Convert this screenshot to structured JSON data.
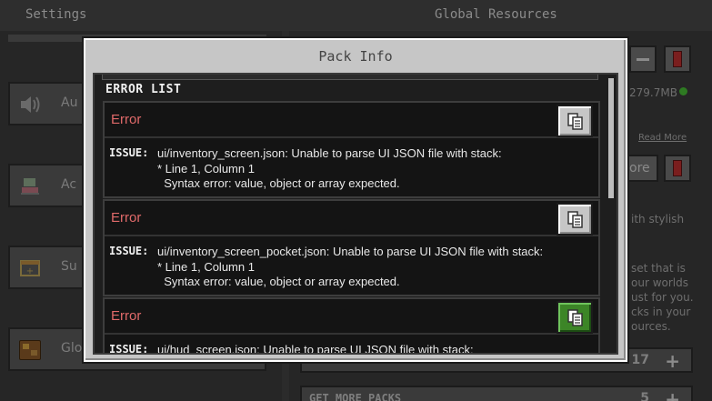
{
  "background": {
    "header_left": "Settings",
    "header_right": "Global Resources",
    "left_items": [
      {
        "label": "Au",
        "icon": "speaker-icon"
      },
      {
        "label": "Ac",
        "icon": "accessibility-icon"
      },
      {
        "label": "Su",
        "icon": "subtitles-icon"
      },
      {
        "label": "Glo",
        "icon": "global-resources-icon"
      }
    ],
    "right": {
      "size_text": "279.7MB",
      "read_more": "Read More",
      "ore_btn": "ore",
      "desc_lines": [
        "ith stylish",
        "set that is",
        "our worlds",
        "ust for you.",
        "cks in your",
        "ources."
      ],
      "pack_count_1": "17",
      "get_more_packs": "GET MORE PACKS",
      "pack_count_2": "5"
    }
  },
  "dialog": {
    "title": "Pack Info",
    "section_header": "ERROR LIST",
    "errors": [
      {
        "title": "Error",
        "issue_label": "ISSUE:",
        "issue_text": "ui/inventory_screen.json: Unable to parse UI JSON file with stack:\n* Line 1, Column 1\n  Syntax error: value, object or array expected.",
        "copy_active": false
      },
      {
        "title": "Error",
        "issue_label": "ISSUE:",
        "issue_text": "ui/inventory_screen_pocket.json: Unable to parse UI JSON file with stack:\n* Line 1, Column 1\n  Syntax error: value, object or array expected.",
        "copy_active": false
      },
      {
        "title": "Error",
        "issue_label": "ISSUE:",
        "issue_text": "ui/hud_screen.json: Unable to parse UI JSON file with stack:",
        "copy_active": true
      }
    ]
  },
  "colors": {
    "error_red": "#e06a6a",
    "active_green": "#3c8527",
    "dialog_gray": "#c6c6c6"
  }
}
